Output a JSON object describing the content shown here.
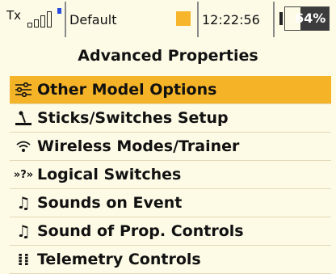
{
  "statusbar": {
    "tx_label": "Tx",
    "model_name": "Default",
    "time": "12:22:56",
    "battery_percent": "64%",
    "battery_level": 0.64,
    "signal_level": 0.4
  },
  "page_title": "Advanced Properties",
  "menu": {
    "items": [
      {
        "label": "Other Model Options",
        "icon": "sliders-icon"
      },
      {
        "label": "Sticks/Switches Setup",
        "icon": "stick-icon"
      },
      {
        "label": "Wireless Modes/Trainer",
        "icon": "wifi-icon"
      },
      {
        "label": "Logical Switches",
        "icon": "logic-icon",
        "icon_text": "»?»"
      },
      {
        "label": "Sounds on Event",
        "icon": "music-note-icon",
        "icon_text": "♫"
      },
      {
        "label": "Sound of Prop. Controls",
        "icon": "music-note-icon",
        "icon_text": "♫"
      },
      {
        "label": "Telemetry Controls",
        "icon": "telemetry-icon",
        "icon_text": "⁞⁞"
      }
    ],
    "selected_index": 0
  },
  "colors": {
    "highlight": "#f5b427",
    "background": "#fdfbe6",
    "model_indicator": "#f6b52a",
    "signal_dot": "#2a4be0"
  }
}
